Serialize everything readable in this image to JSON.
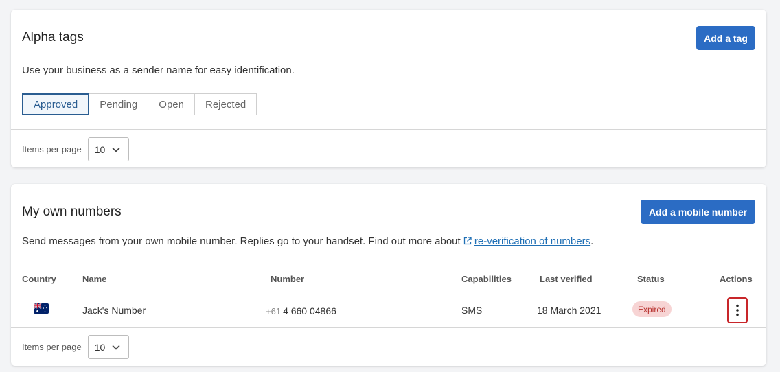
{
  "alpha_tags": {
    "title": "Alpha tags",
    "add_button": "Add a tag",
    "description": "Use your business as a sender name for easy identification.",
    "tabs": [
      {
        "label": "Approved",
        "active": true
      },
      {
        "label": "Pending",
        "active": false
      },
      {
        "label": "Open",
        "active": false
      },
      {
        "label": "Rejected",
        "active": false
      }
    ],
    "items_per_page_label": "Items per page",
    "items_per_page_value": "10"
  },
  "own_numbers": {
    "title": "My own numbers",
    "add_button": "Add a mobile number",
    "description_prefix": "Send messages from your own mobile number. Replies go to your handset. Find out more about ",
    "link_text": "re-verification of numbers",
    "description_suffix": ".",
    "columns": {
      "country": "Country",
      "name": "Name",
      "number": "Number",
      "capabilities": "Capabilities",
      "last_verified": "Last verified",
      "status": "Status",
      "actions": "Actions"
    },
    "rows": [
      {
        "country_icon": "australia-flag-icon",
        "name": "Jack's Number",
        "number_prefix": "+61",
        "number": "4 660 04866",
        "capabilities": "SMS",
        "last_verified": "18 March 2021",
        "status": "Expired"
      }
    ],
    "items_per_page_label": "Items per page",
    "items_per_page_value": "10"
  },
  "colors": {
    "primary": "#2b6cc4",
    "active_tab": "#2a5d91",
    "expired_badge_bg": "#f7d4d4",
    "expired_badge_text": "#b8322f",
    "link": "#1f6fb5",
    "highlight": "#c8262a"
  }
}
